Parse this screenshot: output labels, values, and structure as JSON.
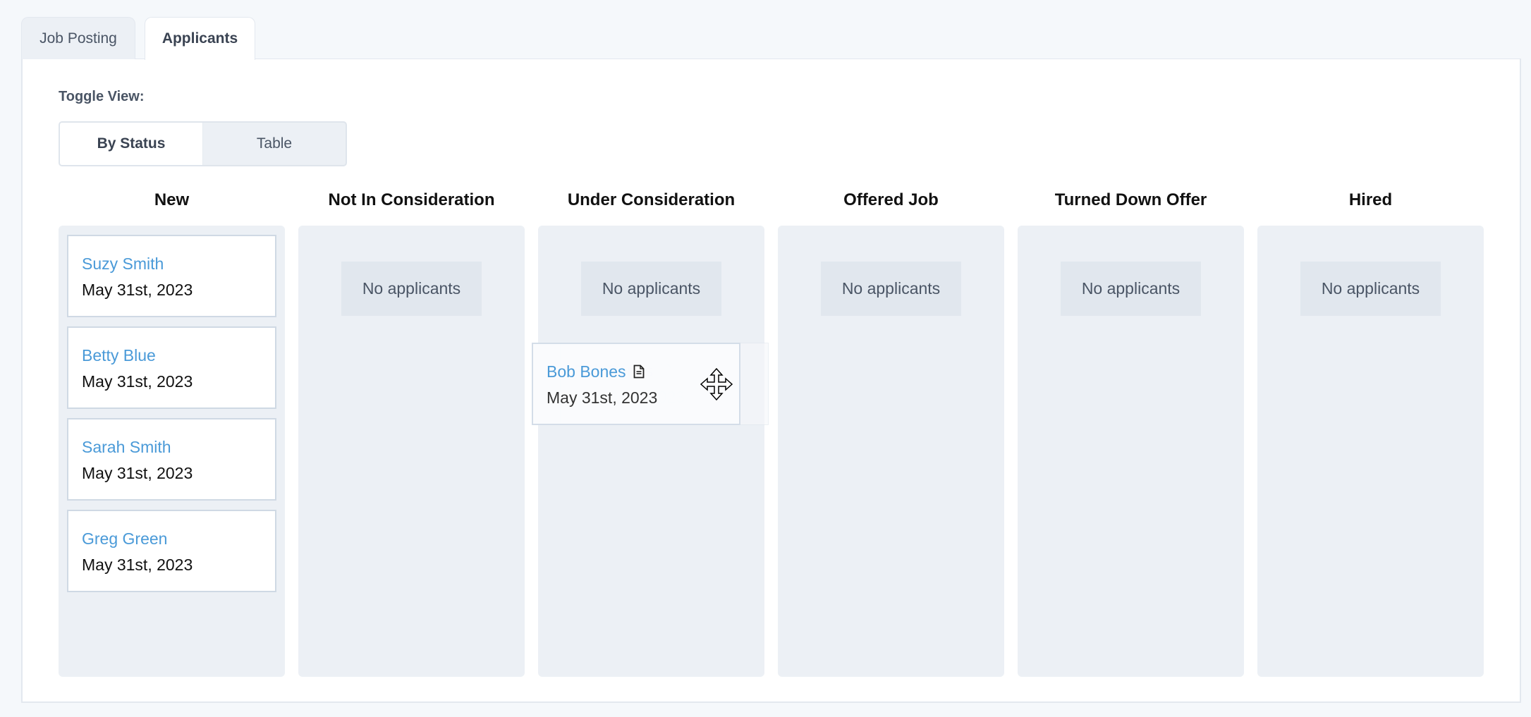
{
  "tabs": [
    {
      "label": "Job Posting",
      "active": false
    },
    {
      "label": "Applicants",
      "active": true
    }
  ],
  "toggle": {
    "label": "Toggle View:",
    "options": [
      {
        "label": "By Status",
        "active": true
      },
      {
        "label": "Table",
        "active": false
      }
    ]
  },
  "board": {
    "empty_text": "No applicants",
    "columns": [
      {
        "title": "New",
        "applicants": [
          {
            "name": "Suzy Smith",
            "date": "May 31st, 2023"
          },
          {
            "name": "Betty Blue",
            "date": "May 31st, 2023"
          },
          {
            "name": "Sarah Smith",
            "date": "May 31st, 2023"
          },
          {
            "name": "Greg Green",
            "date": "May 31st, 2023"
          }
        ]
      },
      {
        "title": "Not In Consideration",
        "applicants": []
      },
      {
        "title": "Under Consideration",
        "applicants": []
      },
      {
        "title": "Offered Job",
        "applicants": []
      },
      {
        "title": "Turned Down Offer",
        "applicants": []
      },
      {
        "title": "Hired",
        "applicants": []
      }
    ],
    "dragging": {
      "name": "Bob Bones",
      "date": "May 31st, 2023",
      "icon": "document-icon",
      "over_column": "Under Consideration",
      "cursor": "move-cursor-icon"
    }
  },
  "colors": {
    "link": "#4a9ad8",
    "column_bg": "#ecf0f5",
    "empty_bg": "#e1e7ee",
    "page_bg": "#f5f8fb"
  }
}
